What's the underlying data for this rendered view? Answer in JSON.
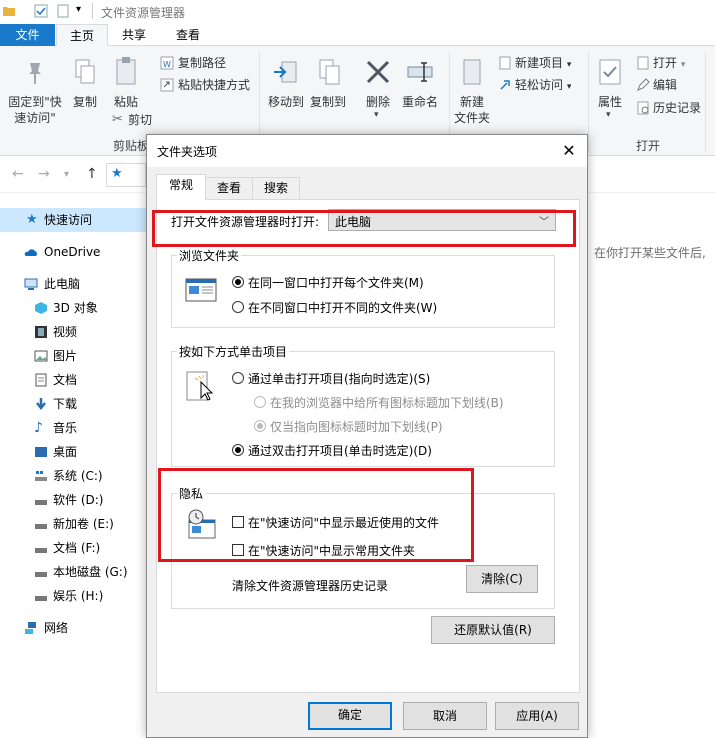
{
  "window": {
    "title": "文件资源管理器"
  },
  "ribbon_tabs": [
    "文件",
    "主页",
    "共享",
    "查看"
  ],
  "ribbon": {
    "pin_label_1": "固定到\"快",
    "pin_label_2": "速访问\"",
    "copy": "复制",
    "paste": "粘贴",
    "copy_path": "复制路径",
    "paste_shortcut": "粘贴快捷方式",
    "cut": "剪切",
    "clipboard_group": "剪贴板",
    "move_to": "移动到",
    "copy_to": "复制到",
    "delete": "删除",
    "rename": "重命名",
    "new_folder_1": "新建",
    "new_folder_2": "文件夹",
    "new_item": "新建项目",
    "easy_access": "轻松访问",
    "properties": "属性",
    "open": "打开",
    "edit": "编辑",
    "history": "历史记录",
    "open_group": "打开"
  },
  "nav": {
    "quick_access": "快速访问",
    "onedrive": "OneDrive",
    "this_pc": "此电脑",
    "items": [
      "3D 对象",
      "视频",
      "图片",
      "文档",
      "下载",
      "音乐",
      "桌面",
      "系统 (C:)",
      "软件 (D:)",
      "新加卷 (E:)",
      "文档 (F:)",
      "本地磁盘 (G:)",
      "娱乐 (H:)"
    ],
    "network": "网络"
  },
  "right_hint": "在你打开某些文件后,",
  "dialog": {
    "title": "文件夹选项",
    "tabs": [
      "常规",
      "查看",
      "搜索"
    ],
    "open_in_label": "打开文件资源管理器时打开:",
    "open_in_value": "此电脑",
    "browse_group": "浏览文件夹",
    "browse_same": "在同一窗口中打开每个文件夹(M)",
    "browse_new": "在不同窗口中打开不同的文件夹(W)",
    "click_group": "按如下方式单击项目",
    "single_click": "通过单击打开项目(指向时选定)(S)",
    "underline_browser": "在我的浏览器中给所有图标标题加下划线(B)",
    "underline_hover": "仅当指向图标标题时加下划线(P)",
    "double_click": "通过双击打开项目(单击时选定)(D)",
    "privacy_group": "隐私",
    "show_recent": "在\"快速访问\"中显示最近使用的文件",
    "show_frequent": "在\"快速访问\"中显示常用文件夹",
    "clear_history_label": "清除文件资源管理器历史记录",
    "clear_button": "清除(C)",
    "restore_button": "还原默认值(R)",
    "ok_button": "确定",
    "cancel_button": "取消",
    "apply_button": "应用(A)"
  },
  "colors": {
    "accent": "#1979ca",
    "highlight_red": "#e0161e",
    "selection": "#cce8ff"
  }
}
